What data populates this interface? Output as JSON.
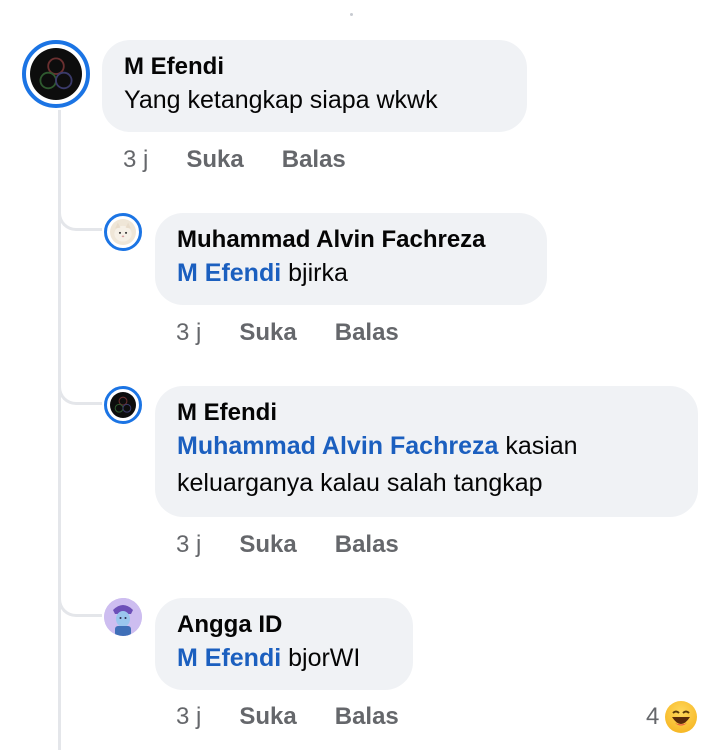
{
  "comments": [
    {
      "author": "M Efendi",
      "text": "Yang ketangkap siapa wkwk",
      "time": "3 j",
      "like_label": "Suka",
      "reply_label": "Balas"
    },
    {
      "author": "Muhammad Alvin Fachreza",
      "mention": "M Efendi",
      "text": " bjirka",
      "time": "3 j",
      "like_label": "Suka",
      "reply_label": "Balas"
    },
    {
      "author": "M Efendi",
      "mention": "Muhammad Alvin Fachreza",
      "text_line1": " kasian",
      "text_line2": "keluarganya kalau salah tangkap",
      "time": "3 j",
      "like_label": "Suka",
      "reply_label": "Balas"
    },
    {
      "author": "Angga ID",
      "mention": "M Efendi",
      "text": " bjorWI",
      "time": "3 j",
      "like_label": "Suka",
      "reply_label": "Balas",
      "reaction_count": "4",
      "reaction_icon": "laughing-emoji-icon"
    }
  ],
  "colors": {
    "bubble": "#f0f2f5",
    "mention": "#1b5fbf",
    "meta": "#65676b",
    "story_ring": "#1b74e4",
    "thread_line": "#e4e6ea"
  }
}
